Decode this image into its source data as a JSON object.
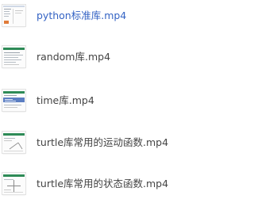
{
  "colors": {
    "text": "#444444",
    "selected_text": "#3463c4",
    "thumb_header_green": "#2e8b57",
    "thumb_header_blue": "#4a6fb5"
  },
  "files": [
    {
      "name": "python标准库.mp4",
      "selected": true,
      "thumbnail_icon": "video-thumbnail-icon"
    },
    {
      "name": "random库.mp4",
      "selected": false,
      "thumbnail_icon": "video-thumbnail-icon"
    },
    {
      "name": "time库.mp4",
      "selected": false,
      "thumbnail_icon": "video-thumbnail-icon"
    },
    {
      "name": "turtle库常用的运动函数.mp4",
      "selected": false,
      "thumbnail_icon": "video-thumbnail-icon"
    },
    {
      "name": "turtle库常用的状态函数.mp4",
      "selected": false,
      "thumbnail_icon": "video-thumbnail-icon"
    }
  ]
}
